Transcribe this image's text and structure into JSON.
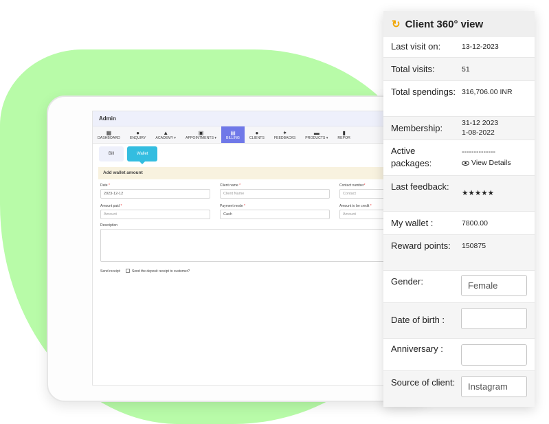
{
  "app": {
    "header": "Admin",
    "menu": [
      {
        "label": "DASHBOARD",
        "icon": "dashboard-icon"
      },
      {
        "label": "ENQUIRY",
        "icon": "info-icon"
      },
      {
        "label": "ACADEMY ▾",
        "icon": "graduation-cap-icon"
      },
      {
        "label": "APPOINTMENTS ▾",
        "icon": "calendar-icon"
      },
      {
        "label": "BILLING",
        "icon": "receipt-icon"
      },
      {
        "label": "CLIENTS",
        "icon": "users-icon"
      },
      {
        "label": "FEEDBACKS",
        "icon": "feedback-icon"
      },
      {
        "label": "PRODUCTS ▾",
        "icon": "products-icon"
      },
      {
        "label": "REPOR",
        "icon": "reports-icon"
      }
    ],
    "active_menu": "BILLING",
    "subtabs": [
      "Bill",
      "Wallet"
    ],
    "active_subtab": "Wallet",
    "panel_title": "Add wallet amount",
    "form": {
      "date_label": "Date",
      "date_value": "2023-12-12",
      "client_name_label": "Client name",
      "client_name_placeholder": "Client Name",
      "contact_label": "Contact number",
      "contact_placeholder": "Contact",
      "amount_paid_label": "Amount paid",
      "amount_paid_placeholder": "Amount",
      "payment_mode_label": "Payment mode",
      "payment_mode_value": "Cash",
      "amount_credit_label": "Amount to be credit",
      "amount_credit_placeholder": "Amount",
      "description_label": "Description",
      "send_receipt_label": "Send receipt:",
      "send_receipt_option": "Send the deposit receipt to customer?",
      "required_mark": "*"
    }
  },
  "client360": {
    "title": "Client 360° view",
    "last_visit_label": "Last visit on:",
    "last_visit_value": "13-12-2023",
    "total_visits_label": "Total visits:",
    "total_visits_value": "51",
    "total_spendings_label": "Total spendings:",
    "total_spendings_value": "316,706.00 INR",
    "membership_label": "Membership:",
    "membership_value_1": "31-12 2023",
    "membership_value_2": "1-08-2022",
    "active_packages_label": "Active packages:",
    "active_packages_value": "--------------",
    "view_details_label": "View Details",
    "last_feedback_label": "Last feedback:",
    "last_feedback_rating": 5,
    "last_feedback_stars": "★★★★★",
    "my_wallet_label": "My wallet :",
    "my_wallet_value": "7800.00",
    "reward_points_label": "Reward points:",
    "reward_points_value": "150875",
    "gender_label": "Gender:",
    "gender_value": "Female",
    "dob_label": "Date of birth :",
    "dob_value": "",
    "anniversary_label": "Anniversary :",
    "anniversary_value": "",
    "source_label": "Source of client:",
    "source_value": "Instagram"
  },
  "colors": {
    "background_blob": "#b8fba8",
    "active_menu": "#6f78e8",
    "active_subtab": "#33bde0",
    "star": "#f5a623",
    "refresh_icon": "#f0a500"
  }
}
